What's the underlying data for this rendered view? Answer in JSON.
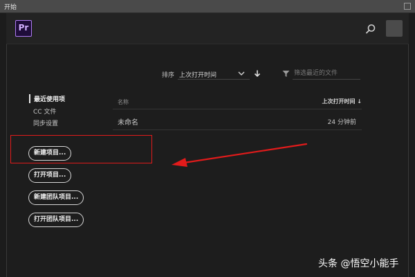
{
  "window": {
    "title": "开始"
  },
  "header": {
    "logo_text": "Pr"
  },
  "sort": {
    "label": "排序",
    "value": "上次打开时间"
  },
  "filter": {
    "placeholder": "筛选最近的文件"
  },
  "nav": {
    "items": [
      "最近使用项",
      "CC 文件",
      "同步设置"
    ]
  },
  "table": {
    "columns": {
      "name": "名称",
      "date": "上次打开时间 ↓"
    },
    "rows": [
      {
        "name": "未命名",
        "date": "24 分钟前"
      }
    ]
  },
  "buttons": {
    "new_project": "新建项目...",
    "open_project": "打开项目...",
    "new_team_project": "新建团队项目...",
    "open_team_project": "打开团队项目..."
  },
  "watermark": "头条 @悟空小能手",
  "colors": {
    "brand": "#b07cf5",
    "annotation": "#e21b1b"
  }
}
